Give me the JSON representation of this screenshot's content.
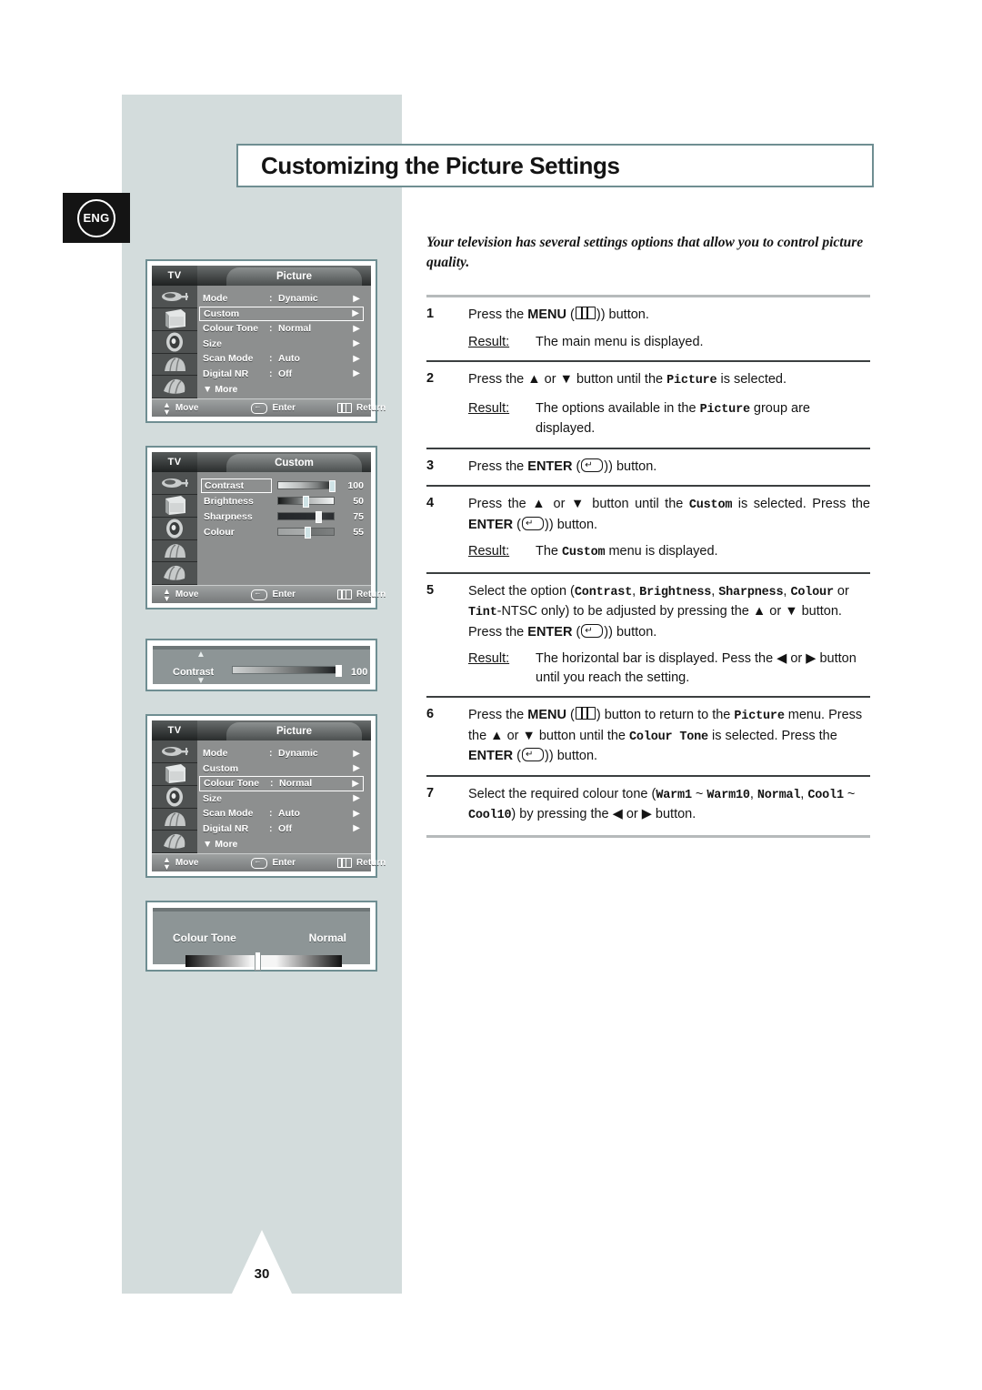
{
  "page": {
    "language_badge": "ENG",
    "title": "Customizing the Picture Settings",
    "intro": "Your television has several settings options that allow you to control picture quality.",
    "page_number": "30"
  },
  "steps": [
    {
      "num": "1",
      "parts": [
        {
          "t": "Press the ",
          "s": "n"
        },
        {
          "t": "MENU",
          "s": "b"
        },
        {
          "t": " (",
          "s": "n"
        },
        {
          "t": "menu-glyph",
          "s": "icon-menu"
        },
        {
          "t": ") button.",
          "s": "n"
        }
      ],
      "result_label": "Result:",
      "result": "The main menu is displayed."
    },
    {
      "num": "2",
      "result_label": "Result:",
      "result": "The options available in the Picture group are displayed."
    },
    {
      "num": "3",
      "result_label": "",
      "result": ""
    },
    {
      "num": "4",
      "result_label": "Result:",
      "result": "The Custom menu is displayed."
    },
    {
      "num": "5",
      "result_label": "Result:",
      "result": "The horizontal bar is displayed. Pess the ◀ or ▶ button until you reach the setting."
    },
    {
      "num": "6"
    },
    {
      "num": "7"
    }
  ],
  "text": {
    "press_the": "Press the",
    "button_word": "button",
    "menu_word": "MENU",
    "enter_word": "ENTER",
    "result_word": "Result:",
    "s1_tail": ") button.",
    "s1_result": "The main menu is displayed.",
    "s2_a": "Press the ▲ or ▼ button until the ",
    "s2_picture": "Picture",
    "s2_b": " is selected.",
    "s2_result_a": "The options available in the ",
    "s2_result_b": " group are displayed.",
    "s3_a": "Press the ",
    "s3_b": ") button.",
    "s4_a": "Press the ▲ or ▼ button until the ",
    "s4_custom": "Custom",
    "s4_b": " is selected. Press the ",
    "s4_c": ") button.",
    "s4_result_a": "The ",
    "s4_result_b": " menu is displayed.",
    "s5_a": "Select the option (",
    "s5_contrast": "Contrast",
    "s5_brightness": "Brightness",
    "s5_sharpness": "Sharpness",
    "s5_colour": "Colour",
    "s5_tint": "Tint",
    "s5_b": "-NTSC only) to be adjusted by pressing the ▲ or ▼ button. Press the ",
    "s5_c": ") button.",
    "s5_result_a": "The horizontal bar is displayed. Pess the ◀ or ▶ button until you reach the setting.",
    "s6_a": " button to return to the ",
    "s6_picture": "Picture",
    "s6_b": " menu. Press the ▲ or ▼ button until the ",
    "s6_colourtone": "Colour Tone",
    "s6_c": " is selected. Press the ",
    "s6_d": ") button.",
    "s7_a": "Select the required colour tone (",
    "s7_warm1": "Warm1",
    "s7_tilde1": " ~ ",
    "s7_warm10": "Warm10",
    "s7_comma1": ", ",
    "s7_normal": "Normal",
    "s7_comma2": ", ",
    "s7_cool1": "Cool1",
    "s7_tilde2": "~ ",
    "s7_cool10": "Cool10",
    "s7_b": ") by pressing the ◀ or ▶ button."
  },
  "osd": {
    "tv_label": "TV",
    "footer": {
      "move": "Move",
      "enter": "Enter",
      "return": "Return"
    },
    "icons": [
      "antenna-icon",
      "picture-icon",
      "sound-icon",
      "channel-icon",
      "setup-icon"
    ],
    "picture_menu_1": {
      "title": "Picture",
      "rows": [
        {
          "label": "Mode",
          "colon": ":",
          "value": "Dynamic",
          "selected": false,
          "arrow": "▶"
        },
        {
          "label": "Custom",
          "colon": "",
          "value": "",
          "selected": true,
          "arrow": "▶"
        },
        {
          "label": "Colour Tone",
          "colon": ":",
          "value": "Normal",
          "selected": false,
          "arrow": "▶"
        },
        {
          "label": "Size",
          "colon": "",
          "value": "",
          "selected": false,
          "arrow": "▶"
        },
        {
          "label": "Scan Mode",
          "colon": ":",
          "value": "Auto",
          "selected": false,
          "arrow": "▶"
        },
        {
          "label": "Digital NR",
          "colon": ":",
          "value": "Off",
          "selected": false,
          "arrow": "▶"
        }
      ],
      "more": "▼ More"
    },
    "custom_menu": {
      "title": "Custom",
      "sliders": [
        {
          "label": "Contrast",
          "value": "100",
          "pct": 97,
          "selected": true
        },
        {
          "label": "Brightness",
          "value": "50",
          "pct": 47,
          "selected": false
        },
        {
          "label": "Sharpness",
          "value": "75",
          "pct": 72,
          "selected": false
        },
        {
          "label": "Colour",
          "value": "55",
          "pct": 52,
          "selected": false
        }
      ]
    },
    "contrast_bar": {
      "label": "Contrast",
      "value": "100",
      "pct": 97
    },
    "picture_menu_2": {
      "title": "Picture",
      "rows": [
        {
          "label": "Mode",
          "colon": ":",
          "value": "Dynamic",
          "selected": false,
          "arrow": "▶"
        },
        {
          "label": "Custom",
          "colon": "",
          "value": "",
          "selected": false,
          "arrow": "▶"
        },
        {
          "label": "Colour Tone",
          "colon": ":",
          "value": "Normal",
          "selected": true,
          "arrow": "▶"
        },
        {
          "label": "Size",
          "colon": "",
          "value": "",
          "selected": false,
          "arrow": "▶"
        },
        {
          "label": "Scan Mode",
          "colon": ":",
          "value": "Auto",
          "selected": false,
          "arrow": "▶"
        },
        {
          "label": "Digital NR",
          "colon": ":",
          "value": "Off",
          "selected": false,
          "arrow": "▶"
        }
      ],
      "more": "▼ More"
    },
    "colour_tone_bar": {
      "label": "Colour Tone",
      "value": "Normal"
    }
  },
  "colors": {
    "page_accent": "#d3dcdc",
    "border_teal": "#6f8e92",
    "osd_grey": "#8d8f8f",
    "knob": "#cfe3e6"
  }
}
